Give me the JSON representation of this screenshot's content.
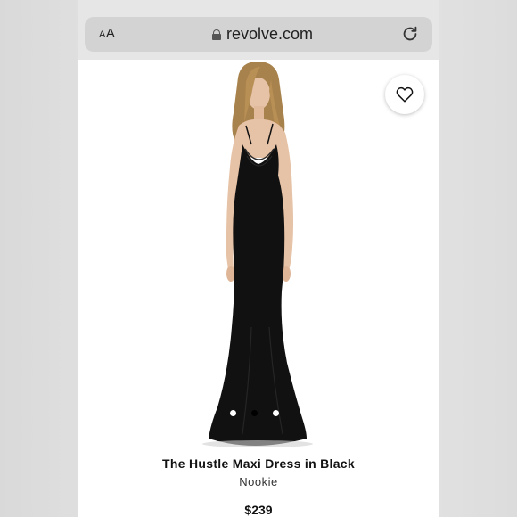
{
  "browser": {
    "text_size_label_small": "A",
    "text_size_label_large": "A",
    "url": "revolve.com",
    "icons": {
      "lock": "lock-icon",
      "reload": "reload-icon"
    }
  },
  "product": {
    "name": "The Hustle Maxi Dress in Black",
    "brand": "Nookie",
    "price": "$239",
    "image_alt": "Model wearing black cowl neck mermaid maxi dress",
    "gallery": {
      "count": 3,
      "active_index": 1
    },
    "wishlist_icon": "heart-icon"
  },
  "colors": {
    "dress": "#111111",
    "accent": "#000000",
    "topbar": "#e6e6e6",
    "urlbar": "#d3d3d3"
  }
}
